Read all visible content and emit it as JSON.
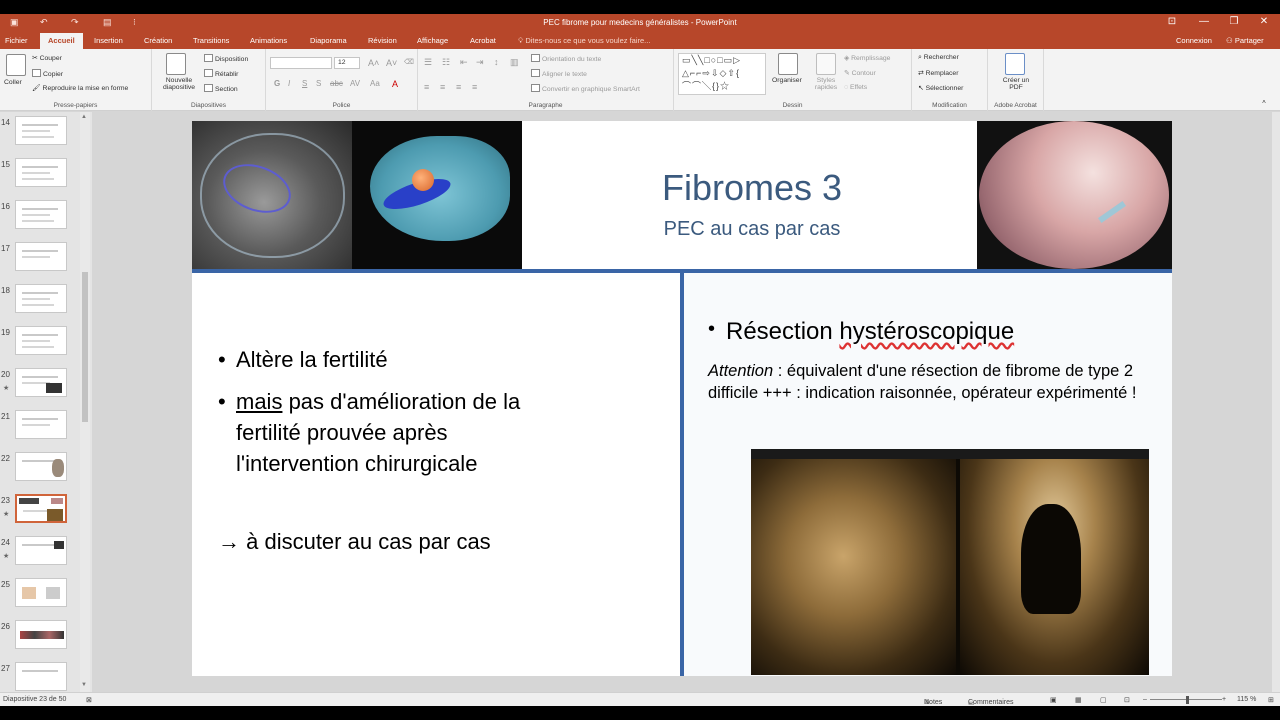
{
  "window": {
    "title": "PEC fibrome pour medecins généralistes - PowerPoint",
    "controls": [
      "⊡",
      "—",
      "❐",
      "✕"
    ]
  },
  "tabs": {
    "items": [
      "Fichier",
      "Accueil",
      "Insertion",
      "Création",
      "Transitions",
      "Animations",
      "Diaporama",
      "Révision",
      "Affichage",
      "Acrobat"
    ],
    "tell_me": "Dites-nous ce que vous voulez faire...",
    "connexion": "Connexion",
    "partager": "Partager"
  },
  "ribbon": {
    "clipboard": {
      "paste": "Coller",
      "cut": "Couper",
      "copy": "Copier",
      "format": "Reproduire la mise en forme",
      "label": "Presse-papiers"
    },
    "slides": {
      "new": "Nouvelle diapositive",
      "layout": "Disposition",
      "reset": "Rétablir",
      "section": "Section",
      "label": "Diapositives"
    },
    "font": {
      "size": "12",
      "label": "Police",
      "bold": "G",
      "italic": "I",
      "underline": "S",
      "shadow": "S",
      "strike": "abc",
      "spacing": "AV",
      "case": "Aa"
    },
    "paragraph": {
      "orientation": "Orientation du texte",
      "align": "Aligner le texte",
      "smartart": "Convertir en graphique SmartArt",
      "label": "Paragraphe"
    },
    "drawing": {
      "arrange": "Organiser",
      "styles": "Styles rapides",
      "fill": "Remplissage",
      "outline": "Contour",
      "effects": "Effets",
      "label": "Dessin"
    },
    "editing": {
      "find": "Rechercher",
      "replace": "Remplacer",
      "select": "Sélectionner",
      "label": "Modification"
    },
    "acrobat": {
      "create_pdf": "Créer un PDF",
      "label": "Adobe Acrobat"
    }
  },
  "thumbnails": [
    {
      "num": "14"
    },
    {
      "num": "15"
    },
    {
      "num": "16"
    },
    {
      "num": "17"
    },
    {
      "num": "18"
    },
    {
      "num": "19"
    },
    {
      "num": "20",
      "star": "★"
    },
    {
      "num": "21"
    },
    {
      "num": "22"
    },
    {
      "num": "23",
      "star": "★"
    },
    {
      "num": "24",
      "star": "★"
    },
    {
      "num": "25"
    },
    {
      "num": "26"
    },
    {
      "num": "27"
    }
  ],
  "slide": {
    "title": "Fibromes 3",
    "subtitle": "PEC au cas par cas",
    "left_bullet_1": "Altère la fertilité",
    "left_bullet_2_underlined": "mais",
    "left_bullet_2_line1_rest": " pas d'amélioration de la",
    "left_bullet_2_line2": "fertilité prouvée après",
    "left_bullet_2_line3": "l'intervention chirurgicale",
    "discuss": "→ à discuter au cas par cas",
    "right_bullet_prefix": "Résection ",
    "right_bullet_word": "hystéroscopique",
    "attention_label": "Attention",
    "attention_text": " : équivalent d'une résection de fibrome de type 2 difficile +++ : indication raisonnée, opérateur expérimenté !"
  },
  "status": {
    "slide_counter": "Diapositive 23 de 50",
    "notes": "Notes",
    "comments": "Commentaires",
    "zoom": "115 %"
  },
  "colors": {
    "accent": "#b7472a",
    "title_blue": "#3b5a7e",
    "divider_blue": "#3a65a6"
  }
}
